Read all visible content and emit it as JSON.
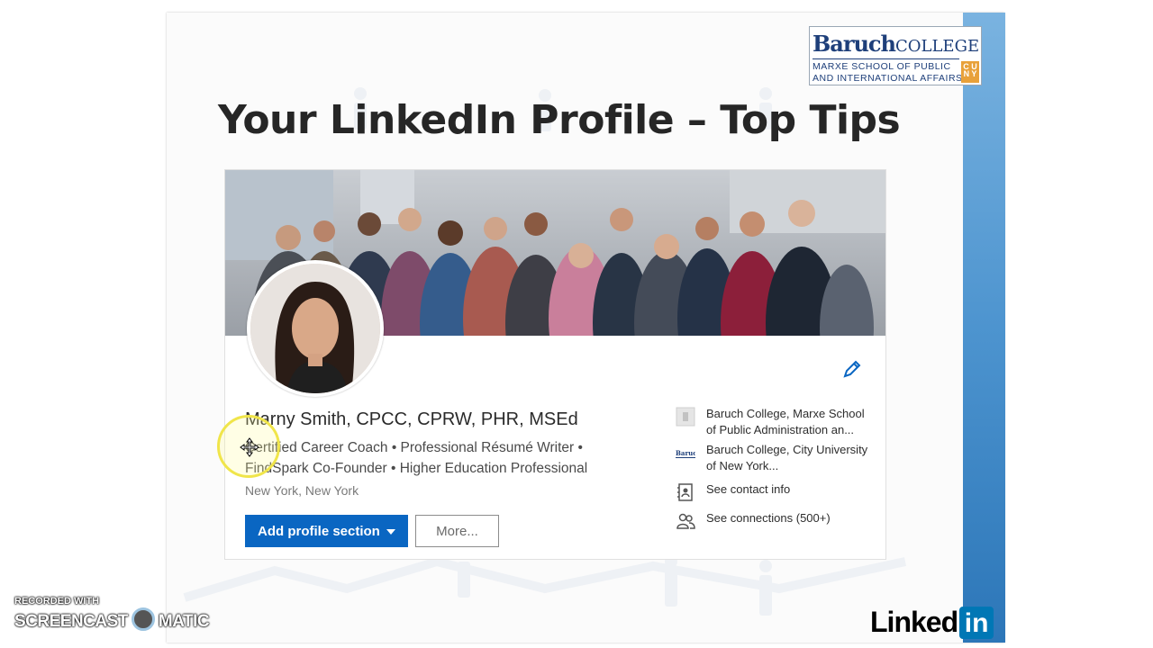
{
  "slide": {
    "title": "Your LinkedIn Profile – Top Tips",
    "logo": {
      "brand_bold": "Baruch",
      "brand_regular": "COLLEGE",
      "sub_line1": "MARXE SCHOOL OF PUBLIC",
      "sub_line2": "AND INTERNATIONAL AFFAIRS",
      "badge": "CUNY"
    },
    "footer_logo": {
      "text": "Linked",
      "box": "in"
    }
  },
  "profile": {
    "name": "Marny Smith, CPCC, CPRW, PHR, MSEd",
    "headline": "Certified Career Coach • Professional Résumé Writer • FindSpark Co-Founder • Higher Education Professional",
    "location": "New York, New York",
    "add_section_label": "Add profile section",
    "more_label": "More...",
    "side": [
      {
        "icon": "building-icon",
        "text": "Baruch College, Marxe School of Public Administration an..."
      },
      {
        "icon": "baruch-logo-icon",
        "text": "Baruch College, City University of New York..."
      },
      {
        "icon": "contact-card-icon",
        "text": "See contact info"
      },
      {
        "icon": "connections-icon",
        "text": "See connections (500+)"
      }
    ]
  },
  "recorder": {
    "line1": "RECORDED WITH",
    "line2a": "SCREENCAST",
    "line2b": "MATIC"
  },
  "colors": {
    "linkedin_blue": "#0a66c2",
    "slide_edge": "#2c76b8",
    "title": "#262626",
    "cursor_highlight": "#f0e54a"
  }
}
